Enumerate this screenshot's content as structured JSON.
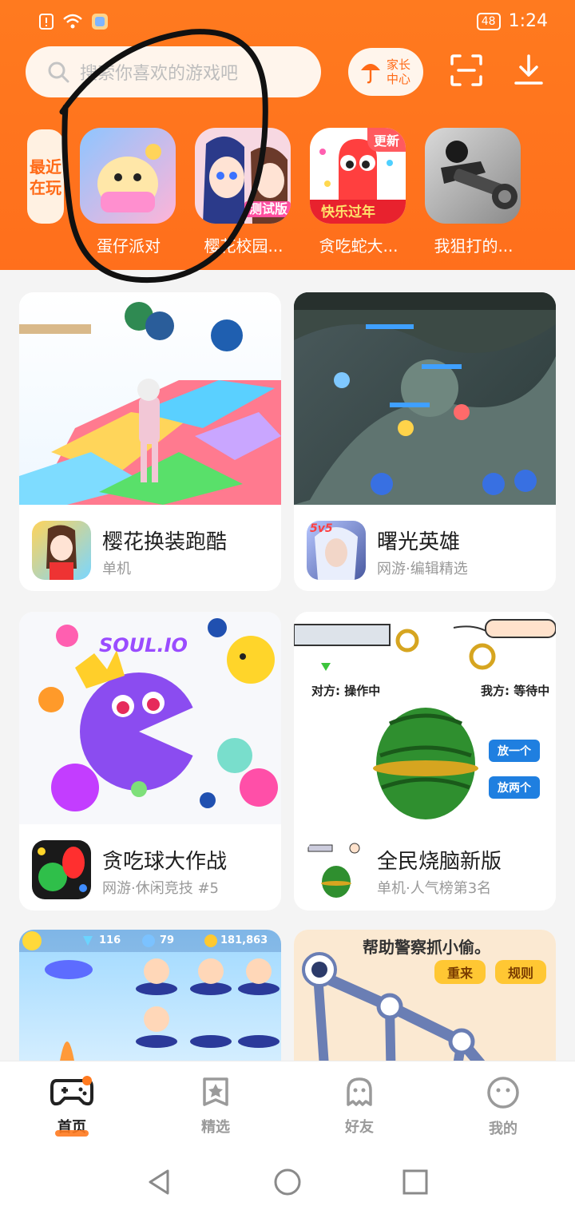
{
  "status_bar": {
    "battery": "48",
    "time": "1:24"
  },
  "search": {
    "placeholder": "搜索你喜欢的游戏吧"
  },
  "header_buttons": {
    "parent_center": "家长中心",
    "scan_icon": "scan-icon",
    "download_icon": "download-icon"
  },
  "recent": {
    "tag": "最近在玩",
    "items": [
      {
        "label": "蛋仔派对"
      },
      {
        "label": "樱花校园..."
      },
      {
        "label": "贪吃蛇大...",
        "badge": "更新"
      },
      {
        "label": "我狙打的..."
      }
    ]
  },
  "cards": [
    {
      "title": "樱花换装跑酷",
      "subtitle": "单机"
    },
    {
      "title": "曙光英雄",
      "subtitle": "网游·编辑精选"
    },
    {
      "title": "贪吃球大作战",
      "subtitle": "网游·休闲竞技 #5"
    },
    {
      "title": "全民烧脑新版",
      "subtitle": "单机·人气榜第3名"
    }
  ],
  "card_texts": {
    "soulio": "SOUL.IO",
    "opponent": "对方: 操作中",
    "me": "我方: 等待中",
    "put_one": "放一个",
    "put_two": "放两个",
    "police": "帮助警察抓小偷。",
    "restart": "重来",
    "rules": "规则",
    "gems": "116",
    "stars": "79",
    "coins": "181,863",
    "five_v_five": "5v5",
    "test_version": "测试版",
    "happy_year": "快乐过年"
  },
  "bottom_nav": [
    {
      "label": "首页",
      "active": true
    },
    {
      "label": "精选"
    },
    {
      "label": "好友"
    },
    {
      "label": "我的"
    }
  ],
  "colors": {
    "brand": "#ff7a1f",
    "accent": "#ff6a17"
  }
}
